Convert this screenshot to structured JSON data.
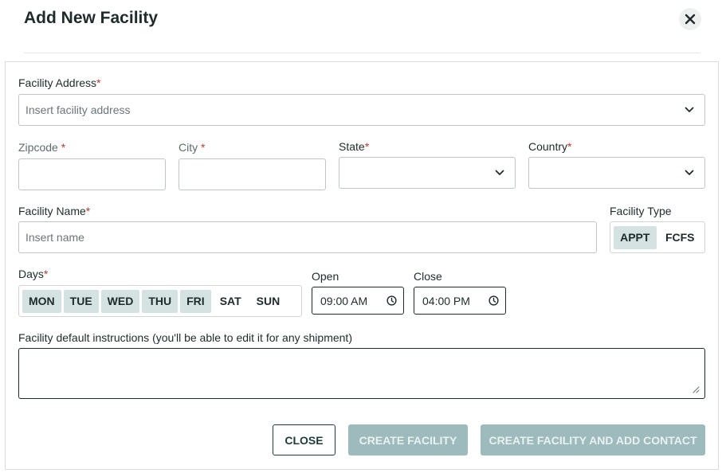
{
  "dialog": {
    "title": "Add New Facility"
  },
  "address": {
    "label": "Facility Address",
    "required": "*",
    "placeholder": "Insert facility address"
  },
  "zipcode": {
    "label": "Zipcode ",
    "required": "*"
  },
  "city": {
    "label": "City ",
    "required": "*"
  },
  "state": {
    "label": "State",
    "required": "*"
  },
  "country": {
    "label": "Country",
    "required": "*"
  },
  "facility_name": {
    "label": "Facility Name",
    "required": "*",
    "placeholder": "Insert name"
  },
  "facility_type": {
    "label": "Facility Type",
    "options": [
      "APPT",
      "FCFS"
    ],
    "selected": "APPT"
  },
  "days": {
    "label": "Days",
    "required": "*",
    "items": [
      "MON",
      "TUE",
      "WED",
      "THU",
      "FRI",
      "SAT",
      "SUN"
    ],
    "selected": [
      "MON",
      "TUE",
      "WED",
      "THU",
      "FRI"
    ]
  },
  "open": {
    "label": "Open",
    "value": "09:00 AM"
  },
  "close_time": {
    "label": "Close",
    "value": "04:00 PM"
  },
  "instructions": {
    "label": "Facility default instructions (you'll be able to edit it for any shipment)"
  },
  "actions": {
    "close": "CLOSE",
    "create": "CREATE FACILITY",
    "create_contact": "CREATE FACILITY AND ADD CONTACT"
  },
  "colors": {
    "accent_chip": "#d5e2e2",
    "primary_disabled": "#9dbbbd",
    "required": "#c0392b",
    "text": "#1f2a2a"
  }
}
